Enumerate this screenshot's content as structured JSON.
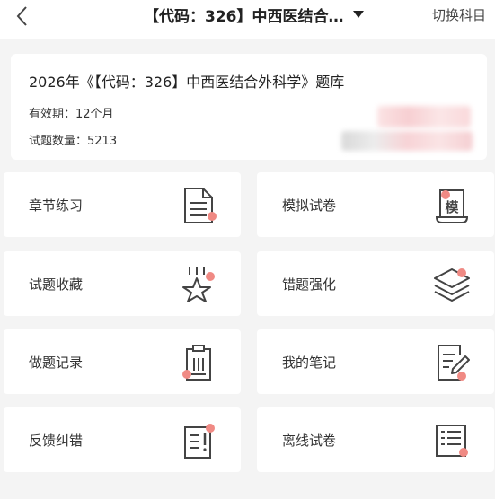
{
  "header": {
    "title": "【代码：326】中西医结合…",
    "switch_label": "切换科目"
  },
  "info": {
    "title": "2026年《【代码：326】中西医结合外科学》题库",
    "validity_label": "有效期：",
    "validity_value": "12个月",
    "count_label": "试题数量：",
    "count_value": "5213"
  },
  "menu": [
    {
      "label": "章节练习",
      "icon": "document-icon"
    },
    {
      "label": "模拟试卷",
      "icon": "scroll-icon"
    },
    {
      "label": "试题收藏",
      "icon": "star-icon"
    },
    {
      "label": "错题强化",
      "icon": "layers-icon"
    },
    {
      "label": "做题记录",
      "icon": "clipboard-icon"
    },
    {
      "label": "我的笔记",
      "icon": "note-pen-icon"
    },
    {
      "label": "反馈纠错",
      "icon": "feedback-icon"
    },
    {
      "label": "离线试卷",
      "icon": "offline-paper-icon"
    }
  ],
  "icon_glyphs": {
    "scroll_char": "模"
  },
  "colors": {
    "accent_dot": "#f08a84",
    "icon_stroke": "#444444",
    "background": "#f4f4f4"
  }
}
